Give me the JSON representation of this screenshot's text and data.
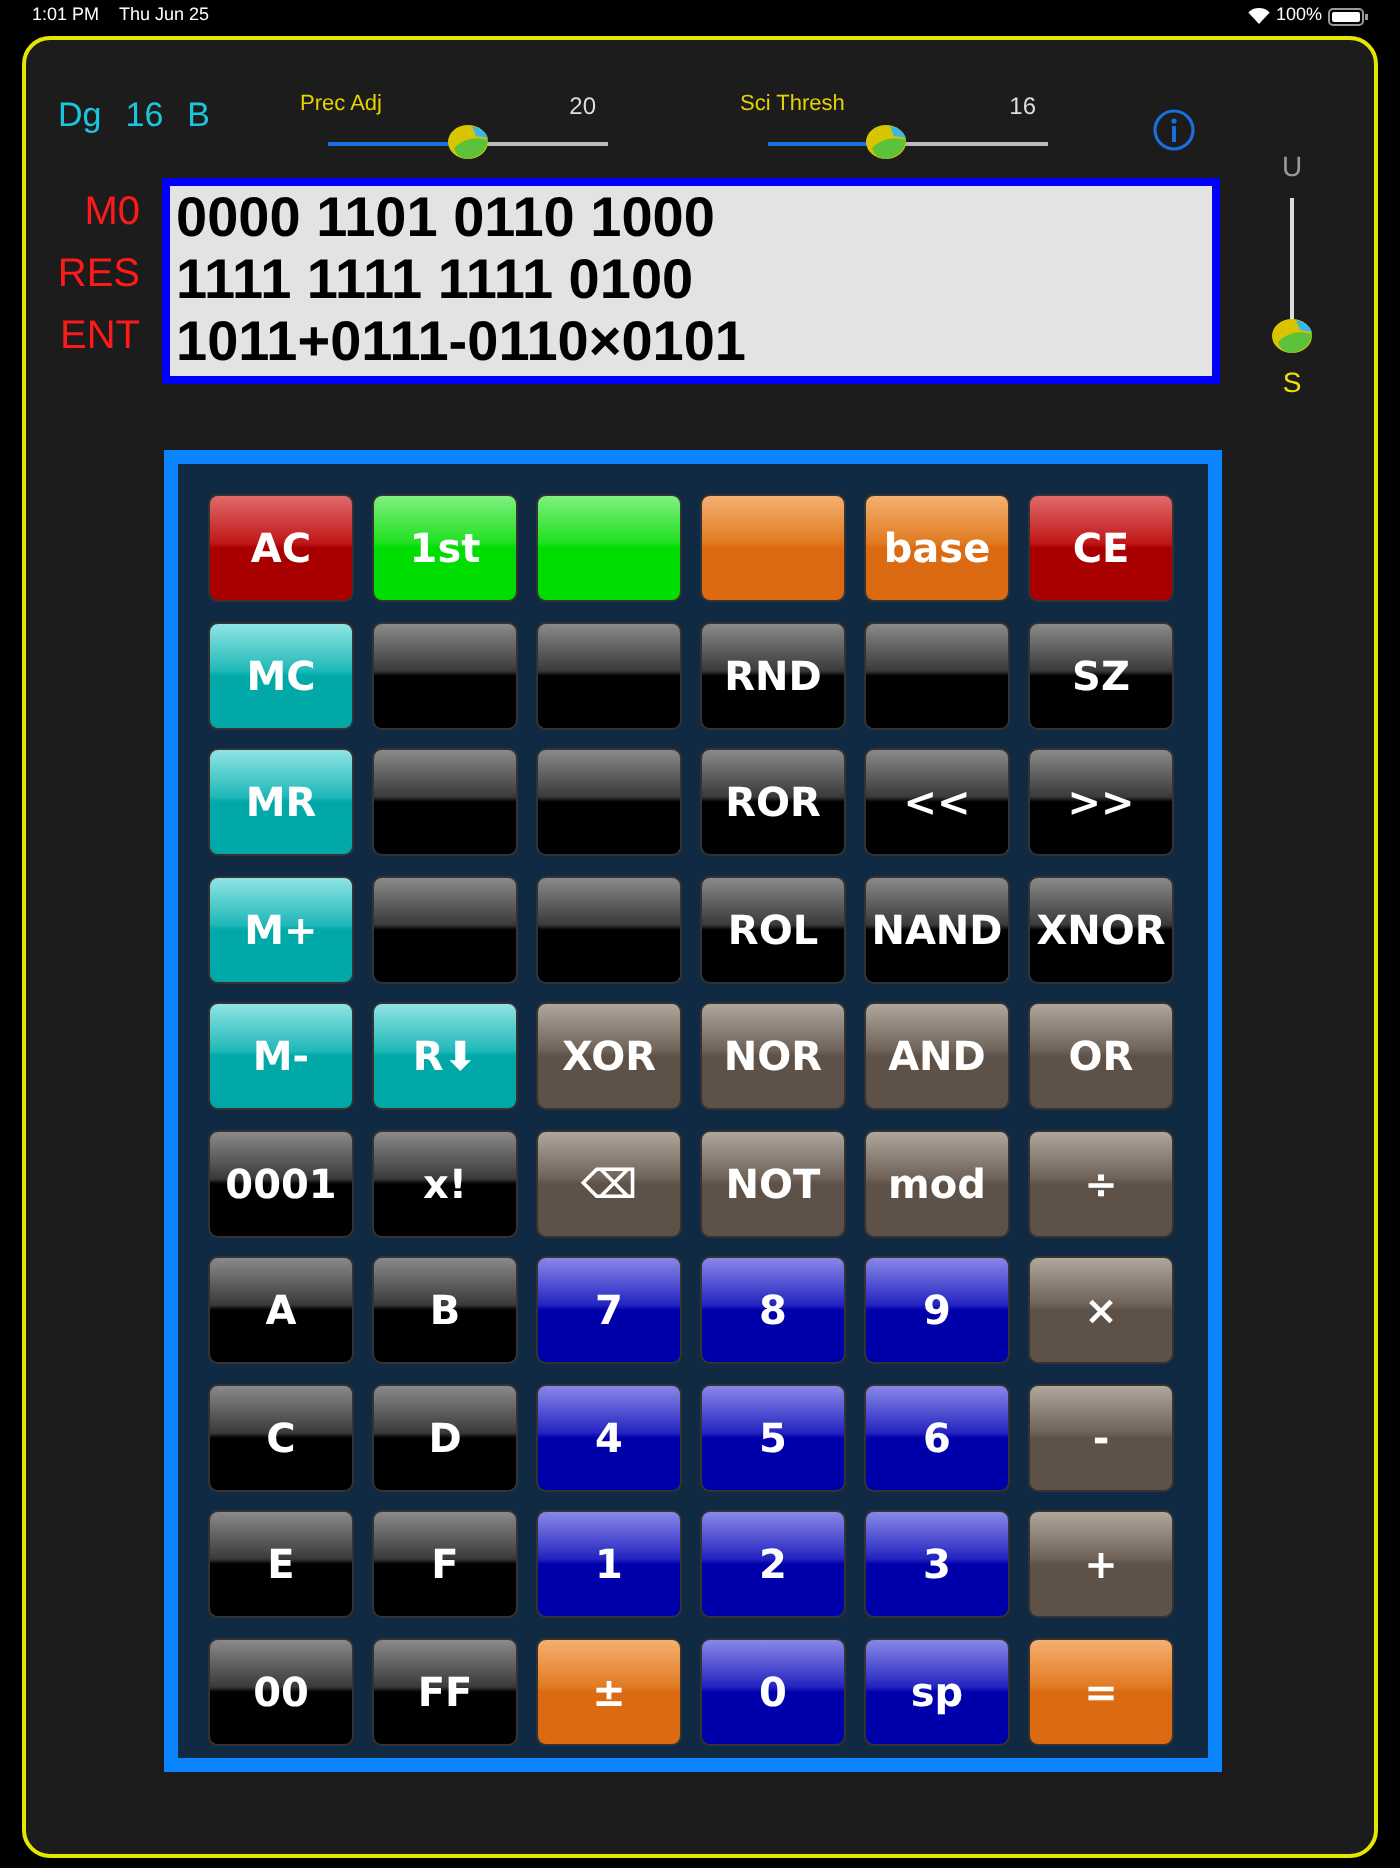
{
  "status_bar": {
    "time": "1:01 PM",
    "date": "Thu Jun 25",
    "battery": "100%"
  },
  "mode": {
    "angle": "Dg",
    "digits": "16",
    "base": "B"
  },
  "sliders": [
    {
      "label": "Prec Adj",
      "value": "20",
      "level": 0.5
    },
    {
      "label": "Sci Thresh",
      "value": "16",
      "level": 0.42
    }
  ],
  "display": {
    "lines": [
      {
        "label": "M0",
        "value": "0000 1101 0110 1000"
      },
      {
        "label": "RES",
        "value": "1111 1111 1111 0100"
      },
      {
        "label": "ENT",
        "value": "1011+0111-0110×0101"
      }
    ]
  },
  "side_switch": {
    "top": "U",
    "bottom": "S",
    "level": 0.05
  },
  "keys": [
    {
      "label": "AC",
      "kind": "red"
    },
    {
      "label": "1st",
      "kind": "green"
    },
    {
      "kind": "green"
    },
    {
      "kind": "orange"
    },
    {
      "label": "base",
      "kind": "orange"
    },
    {
      "label": "CE",
      "kind": "red"
    },
    {
      "label": "MC",
      "kind": "teal"
    },
    {
      "kind": "black"
    },
    {
      "kind": "black"
    },
    {
      "label": "RND",
      "kind": "black"
    },
    {
      "kind": "black"
    },
    {
      "label": "SZ",
      "kind": "black"
    },
    {
      "label": "MR",
      "kind": "teal"
    },
    {
      "kind": "black"
    },
    {
      "kind": "black"
    },
    {
      "label": "ROR",
      "kind": "black"
    },
    {
      "label": "<<",
      "kind": "black"
    },
    {
      "label": ">>",
      "kind": "black"
    },
    {
      "label": "M+",
      "kind": "teal"
    },
    {
      "kind": "black"
    },
    {
      "kind": "black"
    },
    {
      "label": "ROL",
      "kind": "black"
    },
    {
      "label": "NAND",
      "kind": "black"
    },
    {
      "label": "XNOR",
      "kind": "black"
    },
    {
      "label": "M-",
      "kind": "teal"
    },
    {
      "label": "R⬇",
      "kind": "teal"
    },
    {
      "label": "XOR",
      "kind": "brown"
    },
    {
      "label": "NOR",
      "kind": "brown"
    },
    {
      "label": "AND",
      "kind": "brown"
    },
    {
      "label": "OR",
      "kind": "brown"
    },
    {
      "label": "0001",
      "kind": "black"
    },
    {
      "label": "x!",
      "kind": "black"
    },
    {
      "label": "⌫",
      "kind": "brown"
    },
    {
      "label": "NOT",
      "kind": "brown"
    },
    {
      "label": "mod",
      "kind": "brown"
    },
    {
      "label": "÷",
      "kind": "brown"
    },
    {
      "label": "A",
      "kind": "black"
    },
    {
      "label": "B",
      "kind": "black"
    },
    {
      "label": "7",
      "kind": "blue"
    },
    {
      "label": "8",
      "kind": "blue"
    },
    {
      "label": "9",
      "kind": "blue"
    },
    {
      "label": "×",
      "kind": "brown"
    },
    {
      "label": "C",
      "kind": "black"
    },
    {
      "label": "D",
      "kind": "black"
    },
    {
      "label": "4",
      "kind": "blue"
    },
    {
      "label": "5",
      "kind": "blue"
    },
    {
      "label": "6",
      "kind": "blue"
    },
    {
      "label": "-",
      "kind": "brown"
    },
    {
      "label": "E",
      "kind": "black"
    },
    {
      "label": "F",
      "kind": "black"
    },
    {
      "label": "1",
      "kind": "blue"
    },
    {
      "label": "2",
      "kind": "blue"
    },
    {
      "label": "3",
      "kind": "blue"
    },
    {
      "label": "+",
      "kind": "brown"
    },
    {
      "label": "00",
      "kind": "black"
    },
    {
      "label": "FF",
      "kind": "black"
    },
    {
      "label": "±",
      "kind": "orange"
    },
    {
      "label": "0",
      "kind": "blue"
    },
    {
      "label": "sp",
      "kind": "blue"
    },
    {
      "label": "=",
      "kind": "orange"
    }
  ]
}
